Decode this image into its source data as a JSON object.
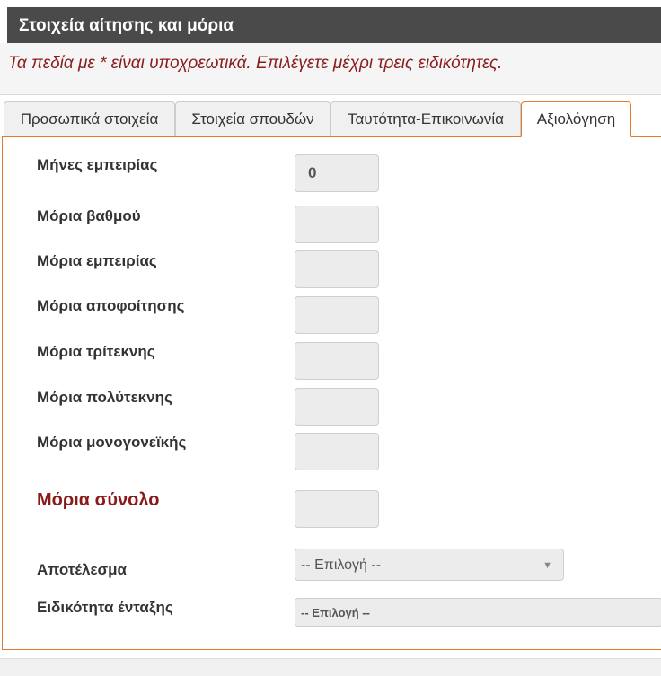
{
  "panel": {
    "title": "Στοιχεία αίτησης και μόρια"
  },
  "notice": "Τα πεδία με * είναι υποχρεωτικά. Επιλέγετε μέχρι τρεις ειδικότητες.",
  "tabs": [
    {
      "label": "Προσωπικά στοιχεία",
      "active": false
    },
    {
      "label": "Στοιχεία σπουδών",
      "active": false
    },
    {
      "label": "Ταυτότητα-Επικοινωνία",
      "active": false
    },
    {
      "label": "Αξιολόγηση",
      "active": true
    }
  ],
  "form": {
    "experience_months": {
      "label": "Μήνες εμπειρίας",
      "value": "0"
    },
    "grade_points": {
      "label": "Μόρια βαθμού",
      "value": ""
    },
    "experience_points": {
      "label": "Μόρια εμπειρίας",
      "value": ""
    },
    "graduation_points": {
      "label": "Μόρια αποφοίτησης",
      "value": ""
    },
    "three_children_points": {
      "label": "Μόρια τρίτεκνης",
      "value": ""
    },
    "many_children_points": {
      "label": "Μόρια πολύτεκνης",
      "value": ""
    },
    "single_parent_points": {
      "label": "Μόρια μονογονεϊκής",
      "value": ""
    },
    "total_points": {
      "label": "Μόρια σύνολο",
      "value": ""
    },
    "result": {
      "label": "Αποτέλεσμα",
      "selected": "-- Επιλογή --"
    },
    "placement_specialty": {
      "label": "Ειδικότητα ένταξης",
      "selected": "-- Επιλογή --"
    }
  },
  "colors": {
    "header_bg": "#4a4a4a",
    "notice_text": "#8a1c1c",
    "total_label": "#8b1a1a",
    "active_tab_border": "#e07b2e"
  }
}
